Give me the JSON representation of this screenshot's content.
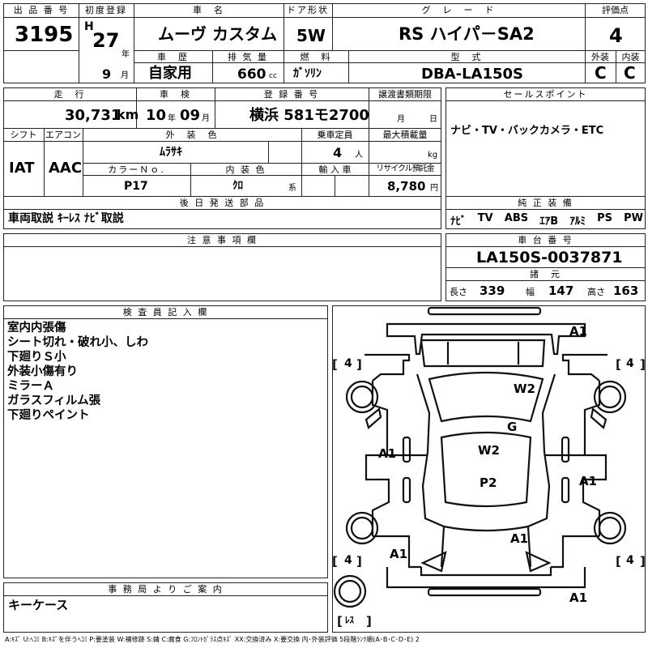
{
  "header": {
    "lot_label": "出 品 番 号",
    "lot_number": "3195",
    "first_reg_label": "初度登録",
    "era": "H",
    "year": "27",
    "year_unit": "年",
    "month": "9",
    "month_unit": "月",
    "car_name_label": "車　名",
    "car_name": "ムーヴ カスタム",
    "door_label": "ドア形状",
    "door": "5W",
    "grade_label": "グ　レ　ー　ド",
    "grade": "RS ハイパ－SA2",
    "score_label": "評価点",
    "score": "4",
    "history_label": "車　歴",
    "history": "自家用",
    "displacement_label": "排 気 量",
    "displacement": "660",
    "displacement_unit": "cc",
    "fuel_label": "燃　料",
    "fuel": "ｶﾞｿﾘﾝ",
    "model_label": "型　式",
    "model": "DBA-LA150S",
    "exterior_label": "外装",
    "exterior": "C",
    "interior_label": "内装",
    "interior": "C"
  },
  "row2": {
    "mileage_label": "走　行",
    "mileage": "30,731",
    "mileage_unit": "km",
    "inspection_label": "車　検",
    "inspection_year": "10",
    "inspection_year_unit": "年",
    "inspection_month": "09",
    "inspection_month_unit": "月",
    "reg_no_label": "登 録 番 号",
    "reg_no": "横浜 581モ2700",
    "transfer_label": "譲渡書類期限",
    "transfer_month_unit": "月",
    "transfer_day_unit": "日",
    "shift_label": "シフト",
    "shift": "IAT",
    "ac_label": "エアコン",
    "ac": "AAC",
    "color_label": "外　装　色",
    "color": "ﾑﾗｻｷ",
    "capacity_label": "乗車定員",
    "capacity": "4",
    "capacity_unit": "人",
    "max_load_label": "最大積載量",
    "max_load_unit": "kg",
    "color_no_label": "カラーＮｏ.",
    "color_no": "P17",
    "int_color_label": "内 装 色",
    "int_color": "ｸﾛ",
    "int_color_unit": "系",
    "import_label": "輸 入 車",
    "recycle_label": "リサイクル預託金",
    "recycle": "8,780",
    "recycle_unit": "円",
    "later_label": "後 日 発 送 部 品",
    "later": "車両取説 ｷｰﾚｽ ﾅﾋﾞ取説"
  },
  "sales": {
    "label": "セールスポイント",
    "text": "ナビ・TV・バックカメラ・ETC",
    "equip_label": "純 正 装 備",
    "equip": [
      "ﾅﾋﾞ",
      "TV",
      "ABS",
      "ｴｱB",
      "ｱﾙﾐ",
      "PS",
      "PW"
    ]
  },
  "notes": {
    "label": "注 意 事 項 欄"
  },
  "chassis": {
    "label": "車 台 番 号",
    "number": "LA150S-0037871",
    "dims_label": "諸　元",
    "length_label": "長さ",
    "length": "339",
    "width_label": "幅",
    "width": "147",
    "height_label": "高さ",
    "height": "163"
  },
  "inspector": {
    "label": "検 査 員 記 入 欄",
    "lines": [
      "室内内張傷",
      "シート切れ・破れ小、しわ",
      "下廻りＳ小",
      "外装小傷有り",
      "ミラーＡ",
      "ガラスフィルム張",
      "下廻りペイント"
    ]
  },
  "office": {
    "label": "事 務 局 よ り ご 案 内",
    "text": "キーケース"
  },
  "diagram": {
    "tire_fl": "4",
    "tire_fr": "4",
    "tire_rl": "4",
    "tire_rr": "4",
    "spare": "ﾚｽ",
    "marks": [
      "A1",
      "W2",
      "G",
      "A1",
      "W2",
      "P2",
      "A1",
      "A1",
      "A1",
      "A1"
    ]
  },
  "legend": "A:ｷｽﾞ U:ﾍｺﾐ B:ｷｽﾞを伴うﾍｺﾐ P:要塗装 W:補修跡 S:錆 C:腐食 G:ﾌﾛﾝﾄｶﾞﾗｽ点ｷｽﾞ XX:交換済み X:要交換 内･外装評価 5段階ﾗﾝｸ順(A･B･C･D･E) 2"
}
